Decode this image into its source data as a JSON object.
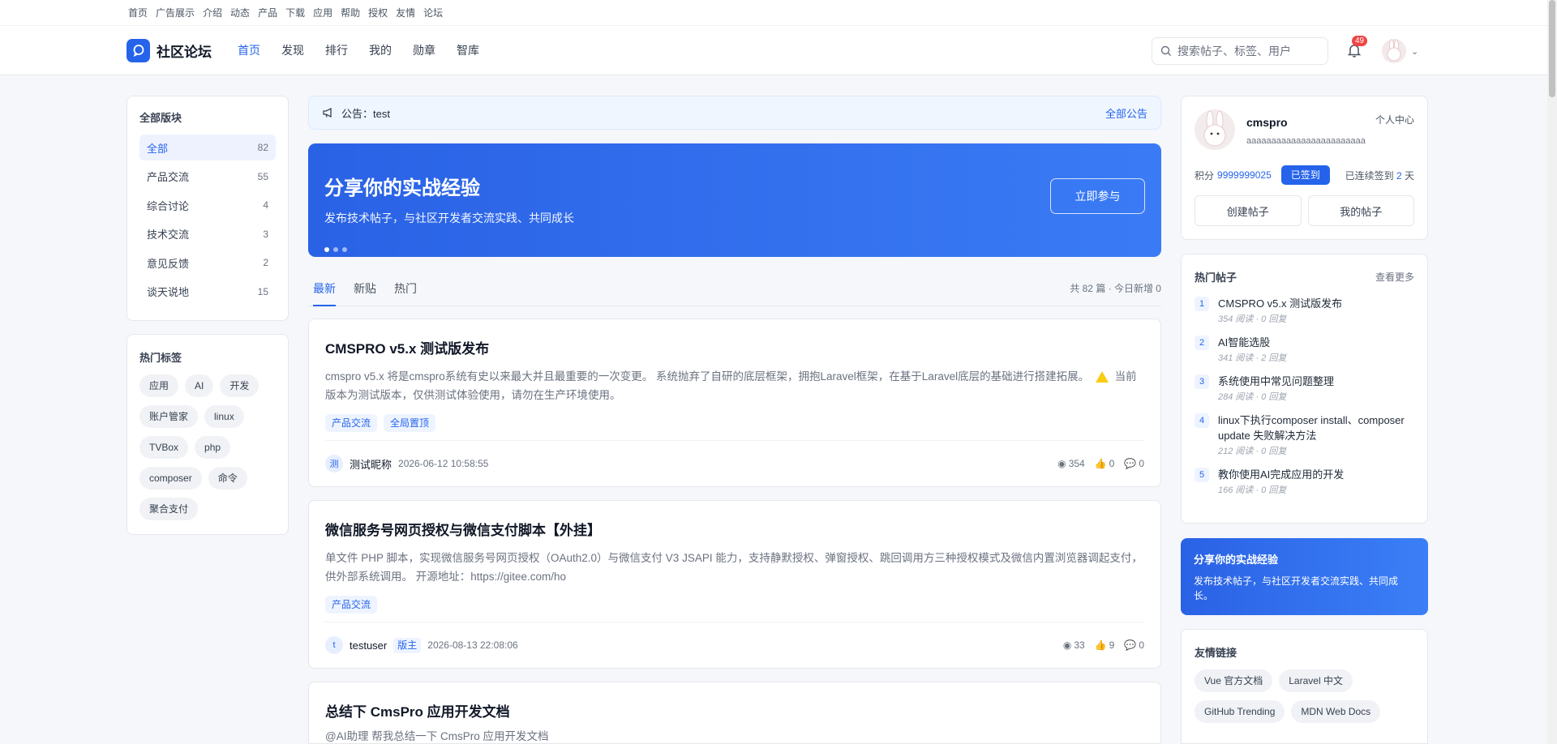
{
  "toplinks": [
    "首页",
    "广告展示",
    "介绍",
    "动态",
    "产品",
    "下载",
    "应用",
    "帮助",
    "授权",
    "友情",
    "论坛"
  ],
  "header": {
    "logo_text": "社区论坛",
    "nav": [
      "首页",
      "发现",
      "排行",
      "我的",
      "勋章",
      "智库"
    ],
    "search_placeholder": "搜索帖子、标签、用户",
    "notif_count": "49"
  },
  "boards": {
    "title": "全部版块",
    "items": [
      {
        "label": "全部",
        "count": "82"
      },
      {
        "label": "产品交流",
        "count": "55"
      },
      {
        "label": "综合讨论",
        "count": "4"
      },
      {
        "label": "技术交流",
        "count": "3"
      },
      {
        "label": "意见反馈",
        "count": "2"
      },
      {
        "label": "谈天说地",
        "count": "15"
      }
    ]
  },
  "hot_tags": {
    "title": "热门标签",
    "items": [
      "应用",
      "AI",
      "开发",
      "账户管家",
      "linux",
      "TVBox",
      "php",
      "composer",
      "命令",
      "聚合支付"
    ]
  },
  "announcement": {
    "text": "公告：test",
    "all_label": "全部公告"
  },
  "banner": {
    "title": "分享你的实战经验",
    "subtitle": "发布技术帖子，与社区开发者交流实践、共同成长",
    "button": "立即参与"
  },
  "tabs": {
    "items": [
      "最新",
      "新贴",
      "热门"
    ],
    "stats": "共 82 篇 · 今日新增 0"
  },
  "posts": [
    {
      "title": "CMSPRO v5.x 测试版发布",
      "excerpt_a": "cmspro v5.x 将是cmspro系统有史以来最大并且最重要的一次变更。 系统抛弃了自研的底层框架，拥抱Laravel框架，在基于Laravel底层的基础进行搭建拓展。",
      "excerpt_b": "当前版本为测试版本，仅供测试体验使用，请勿在生产环境使用。",
      "tags": [
        "产品交流",
        "全局置顶"
      ],
      "author_initial": "测",
      "author": "测试昵称",
      "role": "",
      "time": "2026-06-12 10:58:55",
      "views": "354",
      "likes": "0",
      "comments": "0"
    },
    {
      "title": "微信服务号网页授权与微信支付脚本【外挂】",
      "excerpt_a": "单文件 PHP 脚本，实现微信服务号网页授权（OAuth2.0）与微信支付 V3 JSAPI 能力，支持静默授权、弹窗授权、跳回调用方三种授权模式及微信内置浏览器调起支付，供外部系统调用。 开源地址：https://gitee.com/ho",
      "tags": [
        "产品交流"
      ],
      "author_initial": "t",
      "author": "testuser",
      "role": "版主",
      "time": "2026-08-13 22:08:06",
      "views": "33",
      "likes": "9",
      "comments": "0"
    },
    {
      "title": "总结下 CmsPro 应用开发文档",
      "excerpt_a": "@AI助理 帮我总结一下 CmsPro 应用开发文档"
    }
  ],
  "profile": {
    "name": "cmspro",
    "signature": "aaaaaaaaaaaaaaaaaaaaaaaa",
    "center": "个人中心",
    "points_label": "积分",
    "points": "9999999025",
    "signed_label": "已签到",
    "streak_pre": "已连续签到",
    "streak_days": "2",
    "streak_post": "天",
    "create_btn": "创建帖子",
    "mine_btn": "我的帖子"
  },
  "hot_posts": {
    "title": "热门帖子",
    "more": "查看更多",
    "items": [
      {
        "num": "1",
        "title": "CMSPRO v5.x 测试版发布",
        "sub": "354 阅读 · 0 回复"
      },
      {
        "num": "2",
        "title": "AI智能选股",
        "sub": "341 阅读 · 2 回复"
      },
      {
        "num": "3",
        "title": "系统使用中常见问题整理",
        "sub": "284 阅读 · 0 回复"
      },
      {
        "num": "4",
        "title": "linux下执行composer install、composer update 失败解决方法",
        "sub": "212 阅读 · 0 回复"
      },
      {
        "num": "5",
        "title": "教你使用AI完成应用的开发",
        "sub": "166 阅读 · 0 回复"
      }
    ]
  },
  "promo": {
    "title": "分享你的实战经验",
    "text": "发布技术帖子，与社区开发者交流实践、共同成长。"
  },
  "friend_links": {
    "title": "友情链接",
    "items": [
      "Vue 官方文档",
      "Laravel 中文",
      "GitHub Trending",
      "MDN Web Docs"
    ]
  }
}
